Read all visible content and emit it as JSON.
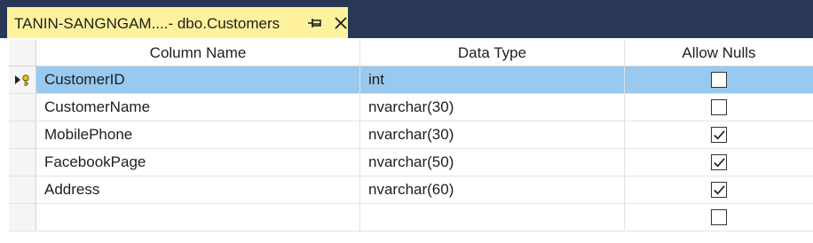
{
  "tab": {
    "title": "TANIN-SANGNGAM....- dbo.Customers"
  },
  "grid": {
    "headers": {
      "column_name": "Column Name",
      "data_type": "Data Type",
      "allow_nulls": "Allow Nulls"
    },
    "rows": [
      {
        "name": "CustomerID",
        "type": "int",
        "allow_nulls": false,
        "primary_key": true,
        "selected": true
      },
      {
        "name": "CustomerName",
        "type": "nvarchar(30)",
        "allow_nulls": false
      },
      {
        "name": "MobilePhone",
        "type": "nvarchar(30)",
        "allow_nulls": true
      },
      {
        "name": "FacebookPage",
        "type": "nvarchar(50)",
        "allow_nulls": true
      },
      {
        "name": "Address",
        "type": "nvarchar(60)",
        "allow_nulls": true
      },
      {
        "name": "",
        "type": "",
        "allow_nulls": false
      }
    ]
  },
  "colors": {
    "title_band": "#293955",
    "active_tab": "#fff29d",
    "selected_row": "#99c9ef"
  },
  "icons": {
    "pin": "pin-icon",
    "close": "close-icon",
    "primary_key": "key-icon",
    "checkmark": "checkmark-icon"
  }
}
